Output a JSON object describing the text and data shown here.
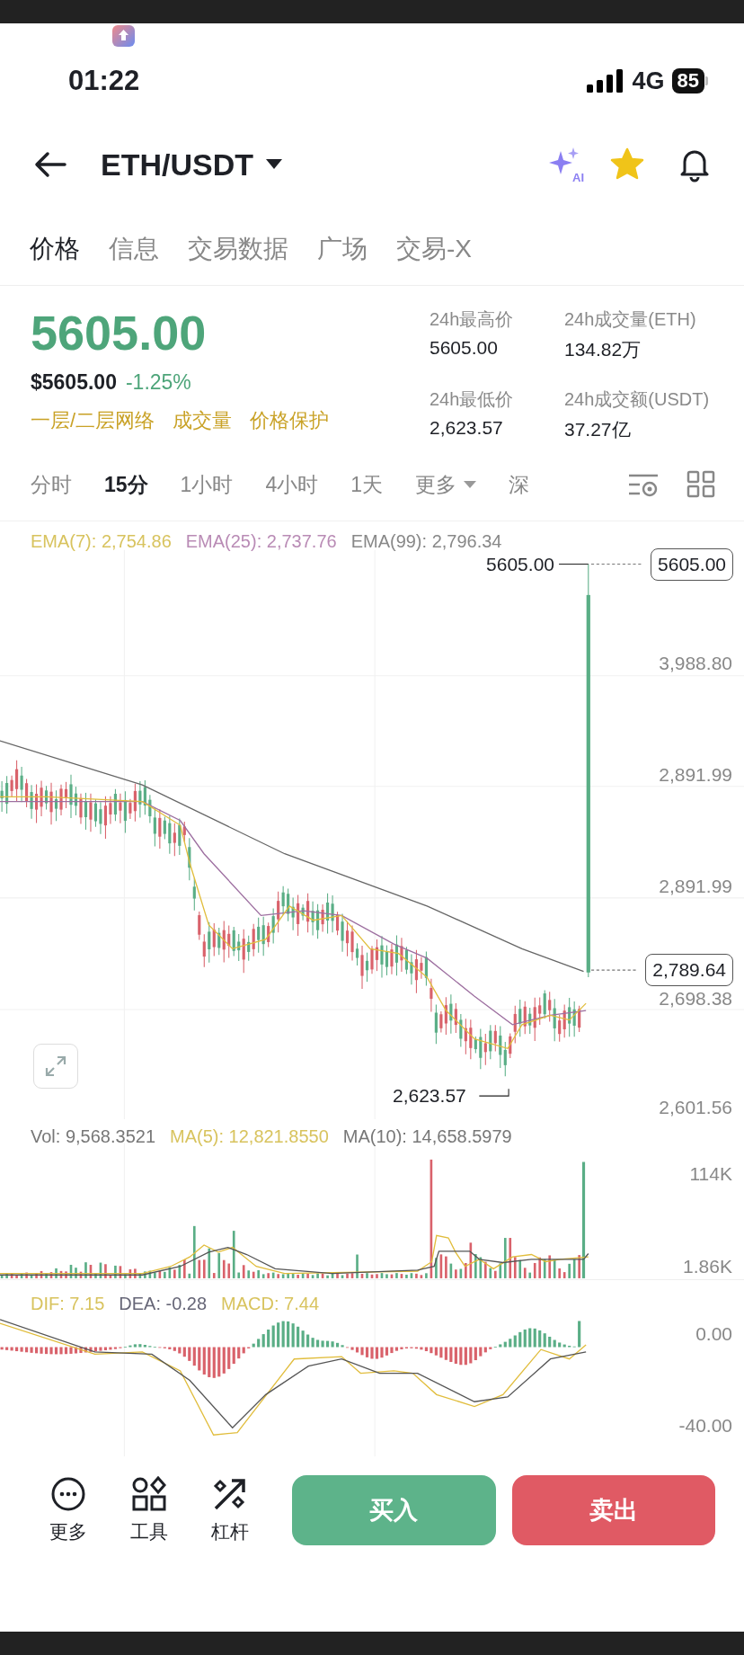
{
  "status_bar": {
    "time": "01:22",
    "network": "4G",
    "battery": "85"
  },
  "header": {
    "pair": "ETH/USDT",
    "ai_badge": "AI",
    "favorite": true
  },
  "tabs": [
    {
      "label": "价格",
      "selected": true
    },
    {
      "label": "信息",
      "selected": false
    },
    {
      "label": "交易数据",
      "selected": false
    },
    {
      "label": "广场",
      "selected": false
    },
    {
      "label": "交易-X",
      "selected": false
    }
  ],
  "price": {
    "last": "5605.00",
    "usd": "$5605.00",
    "change": "-1.25%"
  },
  "tags": [
    "一层/二层网络",
    "成交量",
    "价格保护"
  ],
  "stats": [
    {
      "label": "24h最高价",
      "value": "5605.00"
    },
    {
      "label": "24h成交量(ETH)",
      "value": "134.82万"
    },
    {
      "label": "24h最低价",
      "value": "2,623.57"
    },
    {
      "label": "24h成交额(USDT)",
      "value": "37.27亿"
    }
  ],
  "intervals": [
    {
      "label": "分时",
      "kind": "option",
      "selected": false
    },
    {
      "label": "15分",
      "kind": "option",
      "selected": true
    },
    {
      "label": "1小时",
      "kind": "option",
      "selected": false
    },
    {
      "label": "4小时",
      "kind": "option",
      "selected": false
    },
    {
      "label": "1天",
      "kind": "option",
      "selected": false
    },
    {
      "label": "更多",
      "kind": "dropdown",
      "selected": false
    },
    {
      "label": "深",
      "kind": "option",
      "selected": false
    }
  ],
  "main_chart": {
    "legend": [
      {
        "label": "EMA(7): 2,754.86",
        "color": "#d8c35e"
      },
      {
        "label": "EMA(25): 2,737.76",
        "color": "#b98bb5"
      },
      {
        "label": "EMA(99): 2,796.34",
        "color": "#888888"
      }
    ],
    "axis_labels": [
      "3,988.80",
      "2,891.99",
      "2,891.99",
      "2,698.38",
      "2,601.56"
    ],
    "price_tags": [
      "5605.00",
      "2,789.64"
    ],
    "high_label": "5605.00",
    "low_label": "2,623.57"
  },
  "volume_chart": {
    "legend": [
      {
        "label": "Vol: 9,568.3521",
        "color": "#777777"
      },
      {
        "label": "MA(5): 12,821.8550",
        "color": "#d8c35e"
      },
      {
        "label": "MA(10): 14,658.5979",
        "color": "#777777"
      }
    ],
    "axis_labels": [
      "114K",
      "1.86K"
    ]
  },
  "macd_chart": {
    "legend": [
      {
        "label": "DIF: 7.15",
        "color": "#d8c35e"
      },
      {
        "label": "DEA: -0.28",
        "color": "#666677"
      },
      {
        "label": "MACD: 7.44",
        "color": "#d8c35e"
      }
    ],
    "axis_labels": [
      "0.00",
      "-40.00"
    ]
  },
  "bottom_bar": {
    "tools": [
      {
        "label": "更多",
        "kind": "more"
      },
      {
        "label": "工具",
        "kind": "tools"
      },
      {
        "label": "杠杆",
        "kind": "leverage"
      }
    ],
    "buy": "买入",
    "sell": "卖出"
  }
}
